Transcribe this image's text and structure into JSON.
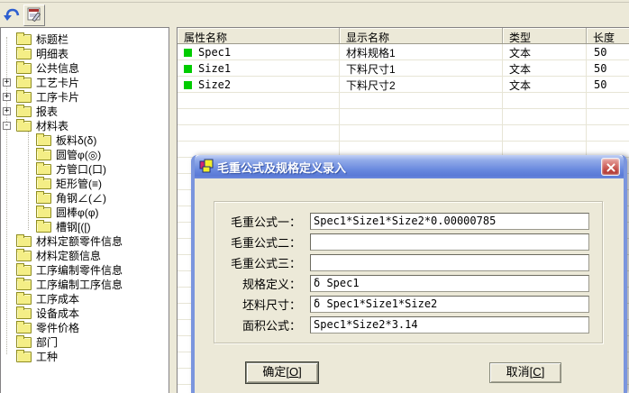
{
  "toolbar": {
    "buttons": [
      {
        "icon": "undo-arrow-icon"
      },
      {
        "icon": "form-edit-icon"
      }
    ]
  },
  "tree": {
    "items": [
      {
        "label": "标题栏",
        "level": 1,
        "expander": ""
      },
      {
        "label": "明细表",
        "level": 1,
        "expander": ""
      },
      {
        "label": "公共信息",
        "level": 1,
        "expander": ""
      },
      {
        "label": "工艺卡片",
        "level": 1,
        "expander": "+"
      },
      {
        "label": "工序卡片",
        "level": 1,
        "expander": "+"
      },
      {
        "label": "报表",
        "level": 1,
        "expander": "+"
      },
      {
        "label": "材料表",
        "level": 1,
        "expander": "-"
      },
      {
        "label": "板料δ(δ)",
        "level": 2,
        "expander": ""
      },
      {
        "label": "圆管φ(◎)",
        "level": 2,
        "expander": ""
      },
      {
        "label": "方管口(口)",
        "level": 2,
        "expander": ""
      },
      {
        "label": "矩形管(≡)",
        "level": 2,
        "expander": ""
      },
      {
        "label": "角钢∠(∠)",
        "level": 2,
        "expander": ""
      },
      {
        "label": "圆棒φ(φ)",
        "level": 2,
        "expander": ""
      },
      {
        "label": "槽钢[([)",
        "level": 2,
        "expander": ""
      },
      {
        "label": "材料定额零件信息",
        "level": 1,
        "expander": ""
      },
      {
        "label": "材料定额信息",
        "level": 1,
        "expander": ""
      },
      {
        "label": "工序编制零件信息",
        "level": 1,
        "expander": ""
      },
      {
        "label": "工序编制工序信息",
        "level": 1,
        "expander": ""
      },
      {
        "label": "工序成本",
        "level": 1,
        "expander": ""
      },
      {
        "label": "设备成本",
        "level": 1,
        "expander": ""
      },
      {
        "label": "零件价格",
        "level": 1,
        "expander": ""
      },
      {
        "label": "部门",
        "level": 1,
        "expander": ""
      },
      {
        "label": "工种",
        "level": 1,
        "expander": ""
      }
    ]
  },
  "table": {
    "columns": [
      "属性名称",
      "显示名称",
      "类型",
      "长度"
    ],
    "marker_color": "#00cc00",
    "rows": [
      {
        "name": "Spec1",
        "display": "材料规格1",
        "type": "文本",
        "length": "50"
      },
      {
        "name": "Size1",
        "display": "下料尺寸1",
        "type": "文本",
        "length": "50"
      },
      {
        "name": "Size2",
        "display": "下料尺寸2",
        "type": "文本",
        "length": "50"
      }
    ]
  },
  "dialog": {
    "title": "毛重公式及规格定义录入",
    "title_icon": "form-icon",
    "close_icon": "close-icon",
    "fields": [
      {
        "label": "毛重公式一：",
        "value": "Spec1*Size1*Size2*0.00000785"
      },
      {
        "label": "毛重公式二：",
        "value": ""
      },
      {
        "label": "毛重公式三：",
        "value": ""
      },
      {
        "label": "规格定义：",
        "value": "δ Spec1"
      },
      {
        "label": "坯料尺寸：",
        "value": "δ Spec1*Size1*Size2"
      },
      {
        "label": "面积公式：",
        "value": "Spec1*Size2*3.14"
      }
    ],
    "buttons": {
      "ok": {
        "pre": "确定[",
        "key": "O",
        "suf": "]"
      },
      "cancel": {
        "pre": "取消[",
        "key": "C",
        "suf": "]"
      }
    }
  }
}
